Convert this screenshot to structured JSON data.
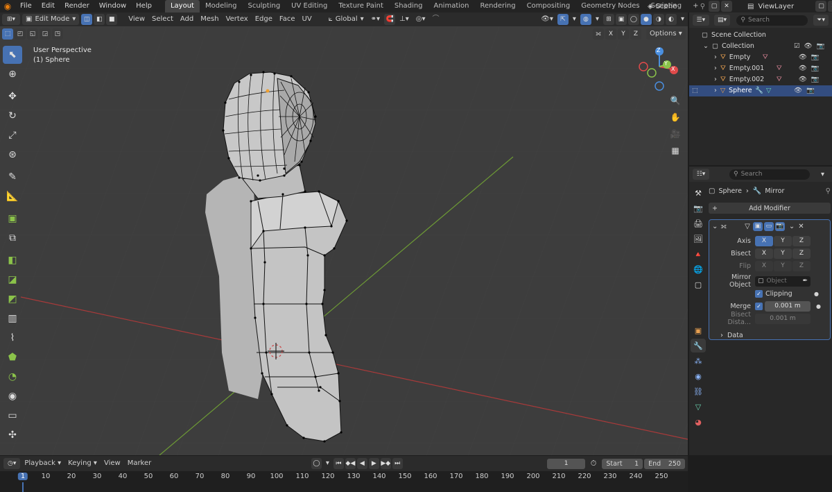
{
  "topbar": {
    "menus": [
      "File",
      "Edit",
      "Render",
      "Window",
      "Help"
    ],
    "workspaces": [
      "Layout",
      "Modeling",
      "Sculpting",
      "UV Editing",
      "Texture Paint",
      "Shading",
      "Animation",
      "Rendering",
      "Compositing",
      "Geometry Nodes",
      "Scripting"
    ],
    "active_workspace": "Layout",
    "add_tab": "+",
    "scene": "Scene",
    "view_layer": "ViewLayer"
  },
  "viewport_header": {
    "mode": "Edit Mode",
    "menus": [
      "View",
      "Select",
      "Add",
      "Mesh",
      "Vertex",
      "Edge",
      "Face",
      "UV"
    ],
    "transform_orientation": "Global",
    "options_label": "Options",
    "axis_x": "X",
    "axis_y": "Y",
    "axis_z": "Z"
  },
  "viewport": {
    "view_name": "User Perspective",
    "object_label": "(1) Sphere",
    "gizmo": {
      "x": "X",
      "y": "Y",
      "z": "Z"
    }
  },
  "outliner": {
    "search_placeholder": "Search",
    "scene_collection": "Scene Collection",
    "collection": "Collection",
    "items": [
      {
        "name": "Empty",
        "selected": false
      },
      {
        "name": "Empty.001",
        "selected": false
      },
      {
        "name": "Empty.002",
        "selected": false
      },
      {
        "name": "Sphere",
        "selected": true
      }
    ]
  },
  "properties": {
    "search_placeholder": "Search",
    "object_name": "Sphere",
    "modifier_name": "Mirror",
    "add_modifier": "Add Modifier",
    "axis_label": "Axis",
    "bisect_label": "Bisect",
    "flip_label": "Flip",
    "x": "X",
    "y": "Y",
    "z": "Z",
    "mirror_object_label": "Mirror Object",
    "mirror_object_placeholder": "Object",
    "clipping_label": "Clipping",
    "merge_label": "Merge",
    "merge_value": "0.001 m",
    "bisect_distance_label": "Bisect Dista...",
    "bisect_distance_value": "0.001 m",
    "data_label": "Data"
  },
  "timeline": {
    "menus": [
      "Playback",
      "Keying",
      "View",
      "Marker"
    ],
    "current_frame": "1",
    "start_label": "Start",
    "start_value": "1",
    "end_label": "End",
    "end_value": "250",
    "ruler": [
      "1",
      "10",
      "20",
      "30",
      "40",
      "50",
      "60",
      "70",
      "80",
      "90",
      "100",
      "110",
      "120",
      "130",
      "140",
      "150",
      "160",
      "170",
      "180",
      "190",
      "200",
      "210",
      "220",
      "230",
      "240",
      "250"
    ]
  },
  "colors": {
    "accent": "#4772b3",
    "x_axis": "#e04a4a",
    "y_axis": "#8bc34a",
    "z_axis": "#4a8fe0"
  }
}
